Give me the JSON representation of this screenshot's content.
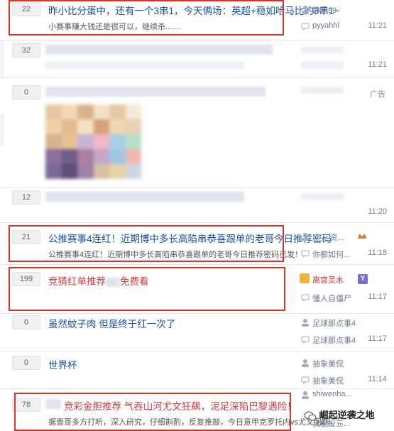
{
  "rows": [
    {
      "count": "22",
      "title": "昨小比分蛋中，还有一个3串1，今天俩场：英超+稳如哈马比的3串1~",
      "sub": "小赛事赚大钱还是很可以，继续杀.......",
      "user1": "静涵99",
      "user2": "pyyahhl",
      "time": "11:21"
    },
    {
      "count": "32",
      "time": "11:21"
    },
    {
      "count": "0",
      "ad": "广告"
    },
    {
      "count": "12",
      "time": "11:20"
    },
    {
      "count": "21",
      "title": "公推赛事4连红！近期博中多长高陷串恭喜跟单的老哥今日推荐密码",
      "sub": "公推赛事4连红！近期博中多长高陷串恭喜跟单的老哥今日推荐密码已发！",
      "user1": "____资...",
      "user2": "你都如何...",
      "time": "11:18"
    },
    {
      "count": "199",
      "title_a": "竞猜红单推荐",
      "title_b": "免费看",
      "user1": "离宫灵水",
      "user2": "懂人自僵尸",
      "time": "11:17"
    },
    {
      "count": "0",
      "title": "虽然蚊子肉 但是终于红一次了",
      "user1": "足球那点事4",
      "user2": "足球那点事4",
      "time": "11:17"
    },
    {
      "count": "0",
      "title": "世界杯",
      "user1": "抽象美侃",
      "user2": "抽象美侃",
      "time": "11:14"
    },
    {
      "count": "78",
      "title": "竞彩金胆推荐 气吞山河尤文狂飙，泥足深陷巴黎遇险！",
      "sub": "据壹哥多方打听，深入研究，仔细斟酌，反复推敲，今日意甲克罗托内vs尤文图斯，...",
      "user1": "shiwenha...",
      "user2": "我能投三..."
    }
  ],
  "watermark": "崛起逆袭之地",
  "colors": {
    "highlight_box": "#d9342b",
    "link": "#1a4fa0",
    "red_title": "#d03c3c"
  }
}
